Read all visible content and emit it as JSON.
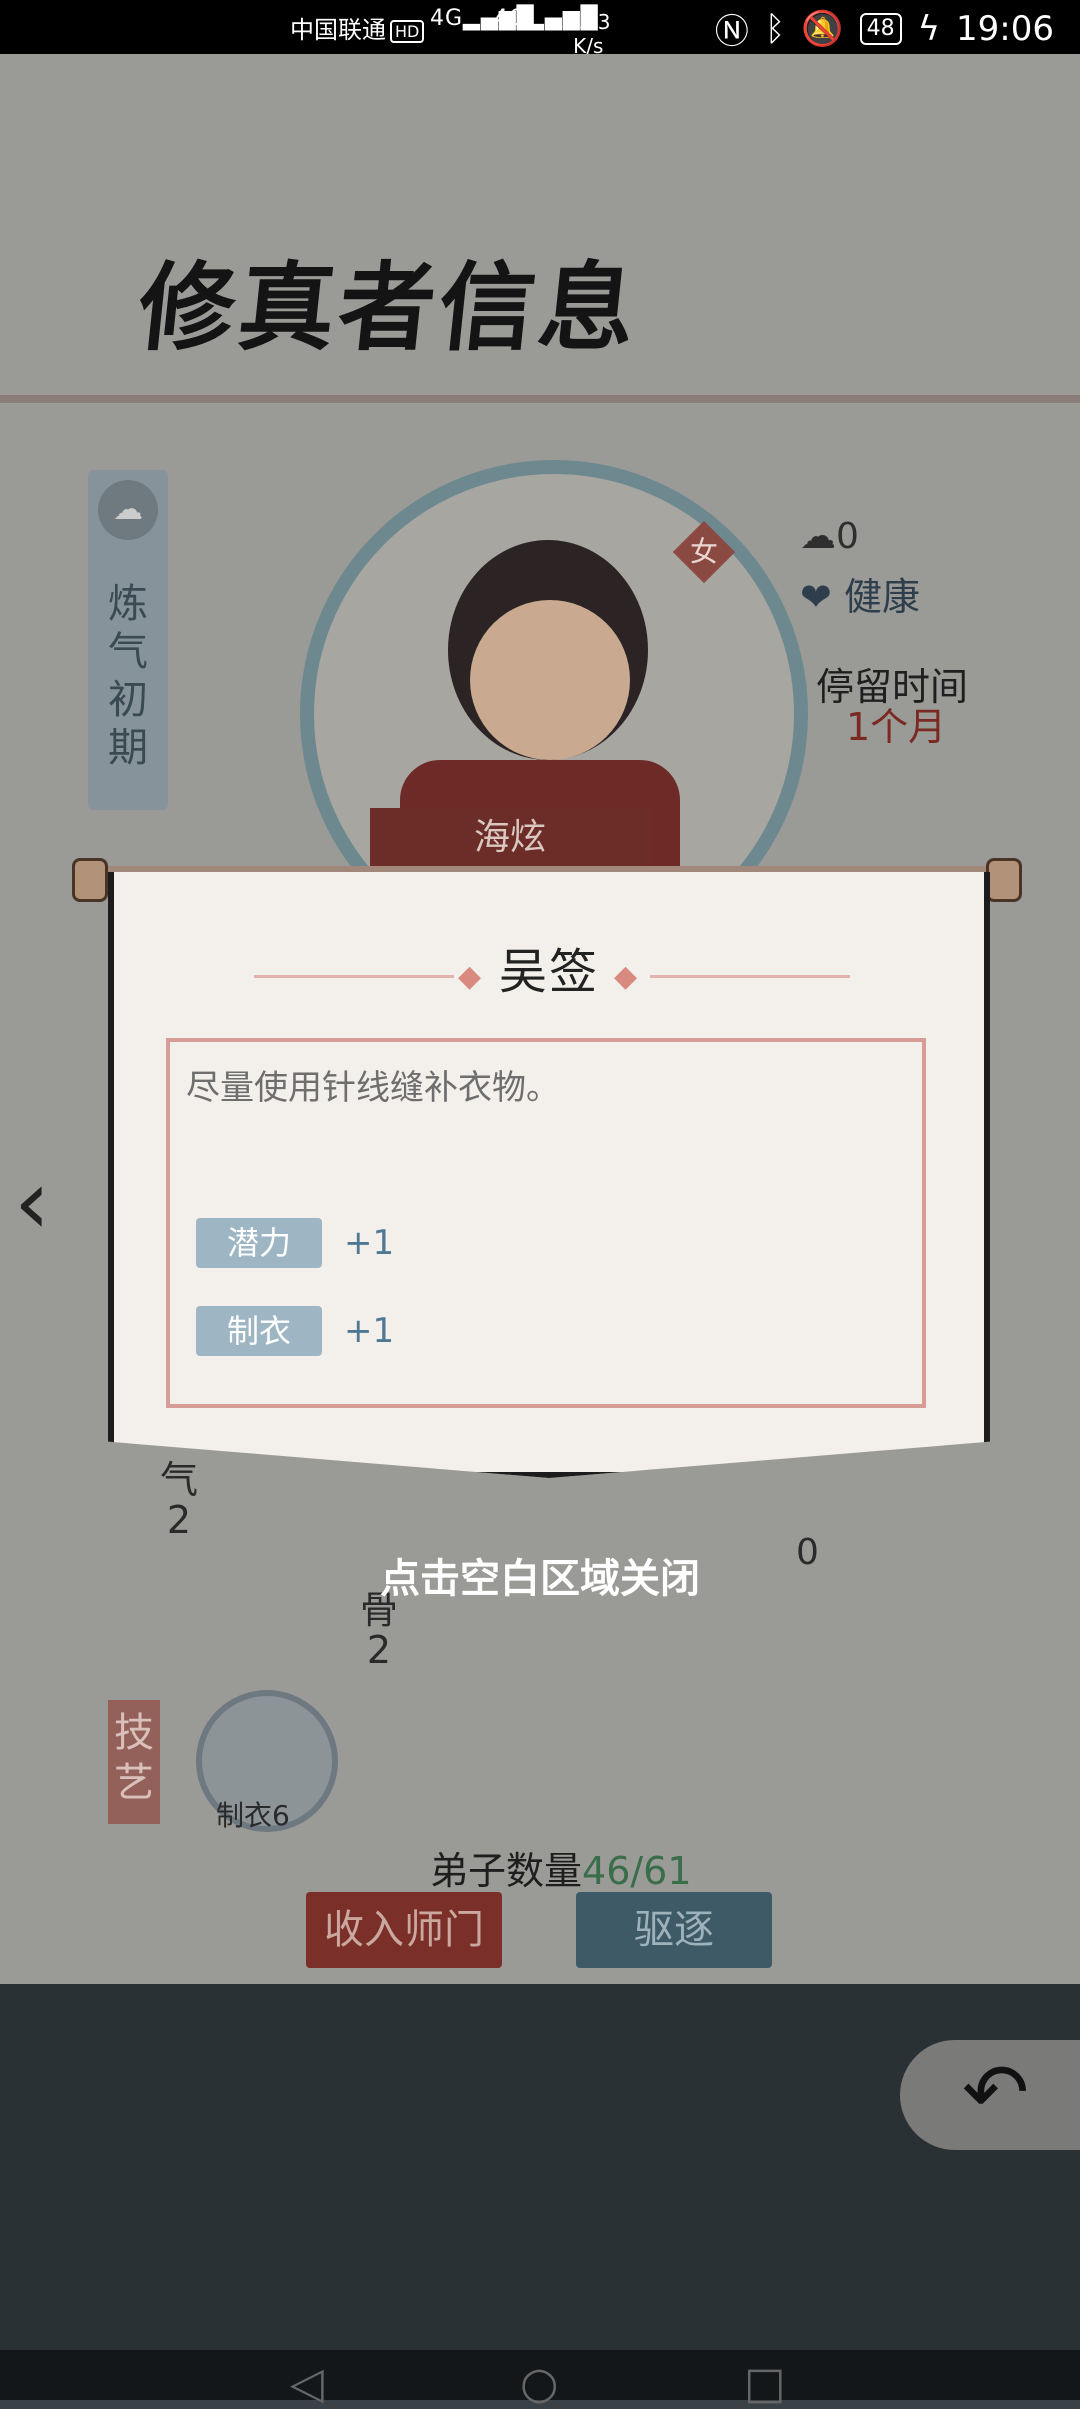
{
  "status_bar": {
    "carrier": "中国联通",
    "hd": "HD",
    "signal1": "4G",
    "signal2": "4G",
    "speed_value": "33.3",
    "speed_unit": "K/s",
    "battery": "48",
    "time": "19:06"
  },
  "page": {
    "title": "修真者信息",
    "realm": "炼气初期",
    "gender": "女",
    "luck": "0",
    "health": "健康",
    "stay_label": "停留时间",
    "stay_value": "1个月",
    "name": "海炫",
    "attr_qi_label": "气",
    "attr_qi_value": "2",
    "attr_gu_label": "骨",
    "attr_gu_value": "2",
    "attr_zero": "0",
    "skill_section": "技艺",
    "skill_label": "制衣6",
    "disciple_label": "弟子数量",
    "disciple_count": "46/61",
    "accept_button": "收入师门",
    "expel_button": "驱逐"
  },
  "dialog": {
    "title": "吴签",
    "description": "尽量使用针线缝补衣物。",
    "effects": [
      {
        "name": "潜力",
        "value": "+1"
      },
      {
        "name": "制衣",
        "value": "+1"
      }
    ]
  },
  "close_hint": "点击空白区域关闭",
  "icons": [
    "luck-icon",
    "health-icon",
    "back-arrow-icon",
    "chevron-left-icon",
    "needle-thread-icon"
  ]
}
